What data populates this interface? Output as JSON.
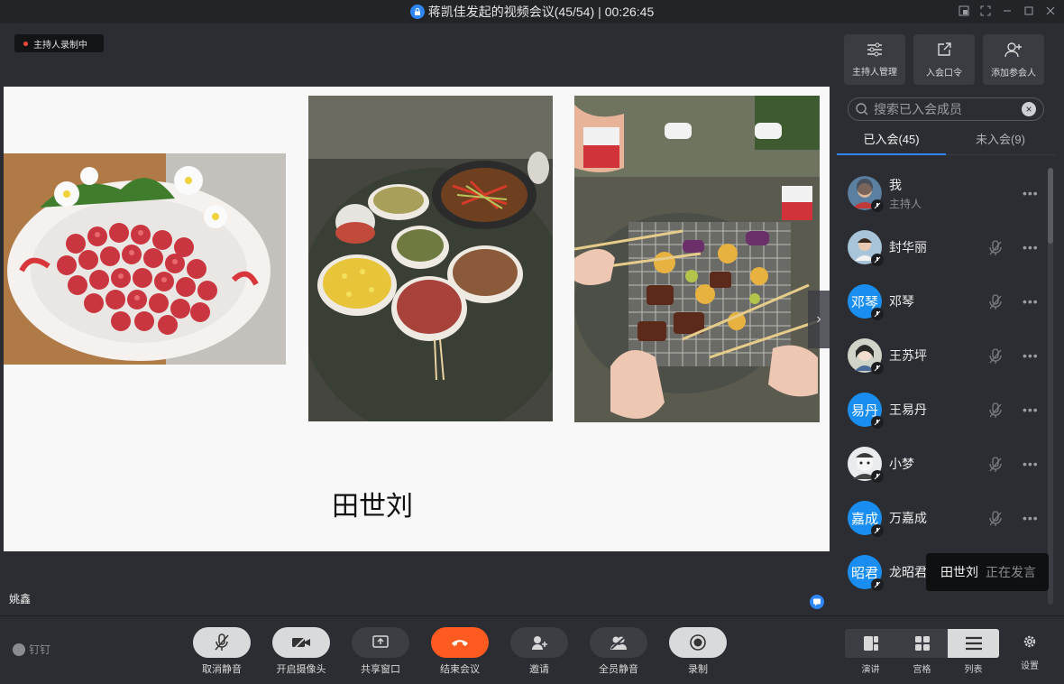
{
  "window": {
    "title": "蒋凯佳发起的视频会议(45/54)",
    "separator": "|",
    "elapsed": "00:26:45"
  },
  "stage": {
    "recording_label": "主持人录制中",
    "slide_caption": "田世刘",
    "speaker_name": "姚鑫"
  },
  "panel": {
    "actions": [
      {
        "label": "主持人管理",
        "icon": "sliders-icon"
      },
      {
        "label": "入会口令",
        "icon": "share-link-icon"
      },
      {
        "label": "添加参会人",
        "icon": "add-person-icon"
      }
    ],
    "search_placeholder": "搜索已入会成员",
    "tabs": [
      {
        "label": "已入会(45)",
        "active": true
      },
      {
        "label": "未入会(9)",
        "active": false
      }
    ],
    "members": [
      {
        "name": "我",
        "role": "主持人",
        "avatar_type": "photo",
        "muted_indicator": false
      },
      {
        "name": "封华丽",
        "role": "",
        "avatar_type": "photo",
        "muted_indicator": true
      },
      {
        "name": "邓琴",
        "role": "",
        "avatar_type": "text",
        "avatar_text": "邓琴",
        "muted_indicator": true
      },
      {
        "name": "王苏坪",
        "role": "",
        "avatar_type": "photo",
        "muted_indicator": true
      },
      {
        "name": "王易丹",
        "role": "",
        "avatar_type": "text",
        "avatar_text": "易丹",
        "muted_indicator": true
      },
      {
        "name": "小梦",
        "role": "",
        "avatar_type": "photo",
        "muted_indicator": true
      },
      {
        "name": "万嘉成",
        "role": "",
        "avatar_type": "text",
        "avatar_text": "嘉成",
        "muted_indicator": true
      },
      {
        "name": "龙昭君",
        "role": "",
        "avatar_type": "text",
        "avatar_text": "昭君",
        "muted_indicator": false
      }
    ],
    "speaking": {
      "who": "田世刘",
      "status": "正在发言"
    }
  },
  "controls": {
    "brand": "钉钉",
    "buttons": [
      {
        "label": "取消静音",
        "icon": "mic-off-icon"
      },
      {
        "label": "开启摄像头",
        "icon": "camera-off-icon"
      },
      {
        "label": "共享窗口",
        "icon": "share-screen-icon"
      },
      {
        "label": "结束会议",
        "icon": "hang-up-icon"
      },
      {
        "label": "邀请",
        "icon": "invite-icon"
      },
      {
        "label": "全员静音",
        "icon": "mute-all-icon"
      },
      {
        "label": "录制",
        "icon": "record-icon"
      }
    ],
    "views": [
      {
        "label": "演讲",
        "active": false
      },
      {
        "label": "宫格",
        "active": false
      },
      {
        "label": "列表",
        "active": true
      }
    ],
    "settings_label": "设置"
  },
  "colors": {
    "accent": "#2f86f6",
    "end_call": "#ff5a1f",
    "recording_dot": "#ff4a3a",
    "background": "#2b2d32"
  }
}
